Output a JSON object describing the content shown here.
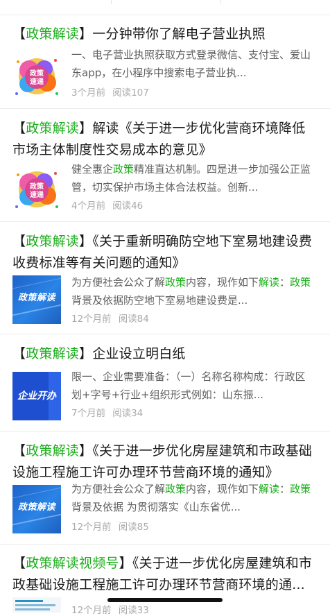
{
  "articles": [
    {
      "tag": "政策解读",
      "title_rest": "一分钟带你了解电子营业执照",
      "thumb_icon": "policy-express-badge-icon",
      "thumb_text": "政策速递",
      "desc_parts": [
        "一、电子营业执照获取方式登录微信、支付宝、爱山东app，在小程序中搜索电子营业执..."
      ],
      "time": "3个月前",
      "reads": "阅读107"
    },
    {
      "tag": "政策解读",
      "title_rest": "解读《关于进一步优化营商环境降低市场主体制度性交易成本的意见》",
      "thumb_icon": "policy-express-badge-icon",
      "thumb_text": "政策速递",
      "desc_a": "健全惠企",
      "desc_hl": "政策",
      "desc_b": "精准直达机制。四是进一步加强公正监管，切实保护市场主体合法权益。创新...",
      "time": "4个月前",
      "reads": "阅读46"
    },
    {
      "tag": "政策解读",
      "title_rest": "《关于重新明确防空地下室易地建设费收费标准等有关问题的通知》",
      "thumb_icon": "policy-interpretation-cover-icon",
      "thumb_text": "政策解读",
      "desc_a": "为方便社会公众了解",
      "desc_hl1": "政策",
      "desc_b": "内容，现作如下",
      "desc_hl2": "解读",
      "desc_c": "：",
      "desc_hl3": "政策",
      "desc_d": "背景及依据防空地下室易地建设费是...",
      "time": "12个月前",
      "reads": "阅读84"
    },
    {
      "tag": "政策解读",
      "title_rest": "企业设立明白纸",
      "thumb_icon": "enterprise-start-cover-icon",
      "thumb_text": "企业开办",
      "desc": "限一、企业需要准备：（一）名称名称构成：行政区划+字号+行业+组织形式例如：山东振...",
      "time": "7个月前",
      "reads": "阅读34"
    },
    {
      "tag": "政策解读",
      "title_rest": "《关于进一步优化房屋建筑和市政基础设施工程施工许可办理环节营商环境的通知》",
      "thumb_icon": "policy-interpretation-cover-icon",
      "thumb_text": "政策解读",
      "desc_a": "为方便社会公众了解",
      "desc_hl1": "政策",
      "desc_b": "内容，现作如下",
      "desc_hl2": "解读",
      "desc_c": "：",
      "desc_hl3": "政策",
      "desc_d": "背景及依据 为贯彻落实《山东省优...",
      "time": "12个月前",
      "reads": "阅读85"
    },
    {
      "tag": "政策解读",
      "tag_suffix": "视频号",
      "title_rest": "《关于进一步优化房屋建筑和市政基础设施工程施工许可办理环节营商环境的通...",
      "thumb_icon": "document-cover-icon",
      "time": "12个月前",
      "reads": "阅读33"
    }
  ],
  "colors": {
    "accent_green": "#1aad19",
    "meta_gray": "#aaaaaa",
    "desc_gray": "#5f5f5f"
  }
}
